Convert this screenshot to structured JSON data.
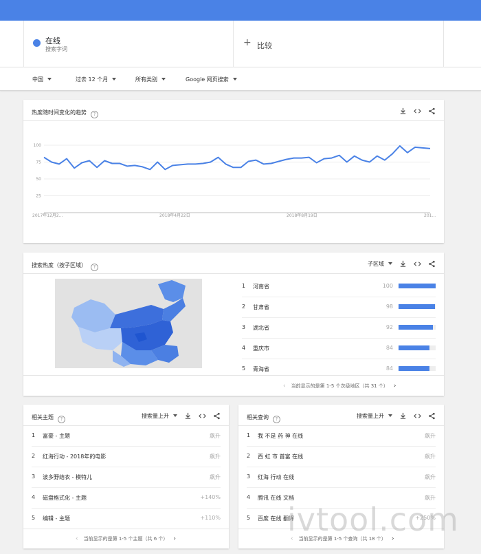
{
  "term": {
    "name": "在线",
    "sub": "搜索字词"
  },
  "compare": {
    "label": "比较"
  },
  "filters": [
    "中国",
    "过去 12 个月",
    "所有类别",
    "Google 网页搜索"
  ],
  "interest_over_time": {
    "title": "热度随时间变化的趋势",
    "chart_data": {
      "type": "line",
      "ylim": [
        0,
        100
      ],
      "yticks": [
        "100",
        "75",
        "50",
        "25"
      ],
      "xticks": [
        "2017年12月2...",
        "2018年4月22日",
        "2018年8月19日",
        "201..."
      ],
      "values": [
        82,
        75,
        72,
        80,
        66,
        74,
        77,
        67,
        77,
        73,
        73,
        69,
        70,
        68,
        64,
        75,
        64,
        70,
        71,
        72,
        72,
        73,
        75,
        82,
        72,
        67,
        67,
        76,
        78,
        72,
        73,
        76,
        79,
        81,
        81,
        82,
        74,
        80,
        81,
        85,
        75,
        84,
        78,
        75,
        84,
        78,
        87,
        99,
        89,
        97,
        96,
        95
      ]
    }
  },
  "by_region": {
    "title": "搜索热度（按子区域）",
    "dropdown": "子区域",
    "rows": [
      {
        "rank": "1",
        "name": "河南省",
        "value": "100",
        "pct": 100
      },
      {
        "rank": "2",
        "name": "甘肃省",
        "value": "98",
        "pct": 98
      },
      {
        "rank": "3",
        "name": "湖北省",
        "value": "92",
        "pct": 92
      },
      {
        "rank": "4",
        "name": "重庆市",
        "value": "84",
        "pct": 84
      },
      {
        "rank": "5",
        "name": "青海省",
        "value": "84",
        "pct": 84
      }
    ],
    "pager": "当前显示的是第 1-5 个次级地区（共 31 个）"
  },
  "related_topics": {
    "title": "相关主题",
    "dropdown": "搜索量上升",
    "rows": [
      {
        "rank": "1",
        "name": "富豪 - 主题",
        "value": "飙升"
      },
      {
        "rank": "2",
        "name": "红海行动 - 2018年的电影",
        "value": "飙升"
      },
      {
        "rank": "3",
        "name": "波多野结衣 - 模特儿",
        "value": "飙升"
      },
      {
        "rank": "4",
        "name": "磁盘格式化 - 主题",
        "value": "+140%"
      },
      {
        "rank": "5",
        "name": "编辑 - 主题",
        "value": "+110%"
      }
    ],
    "pager": "当前显示的是第 1-5 个主题（共 6 个）"
  },
  "related_queries": {
    "title": "相关查询",
    "dropdown": "搜索量上升",
    "rows": [
      {
        "rank": "1",
        "name": "我 不是 药 神 在线",
        "value": "飙升"
      },
      {
        "rank": "2",
        "name": "西 虹 市 首富 在线",
        "value": "飙升"
      },
      {
        "rank": "3",
        "name": "红海 行动 在线",
        "value": "飙升"
      },
      {
        "rank": "4",
        "name": "腾讯 在线 文档",
        "value": "飙升"
      },
      {
        "rank": "5",
        "name": "百度 在线 翻译",
        "value": "+250%"
      }
    ],
    "pager": "当前显示的是第 1-5 个查询（共 18 个）"
  },
  "watermark": "ivtool.com",
  "colors": {
    "accent": "#4a82e6"
  }
}
